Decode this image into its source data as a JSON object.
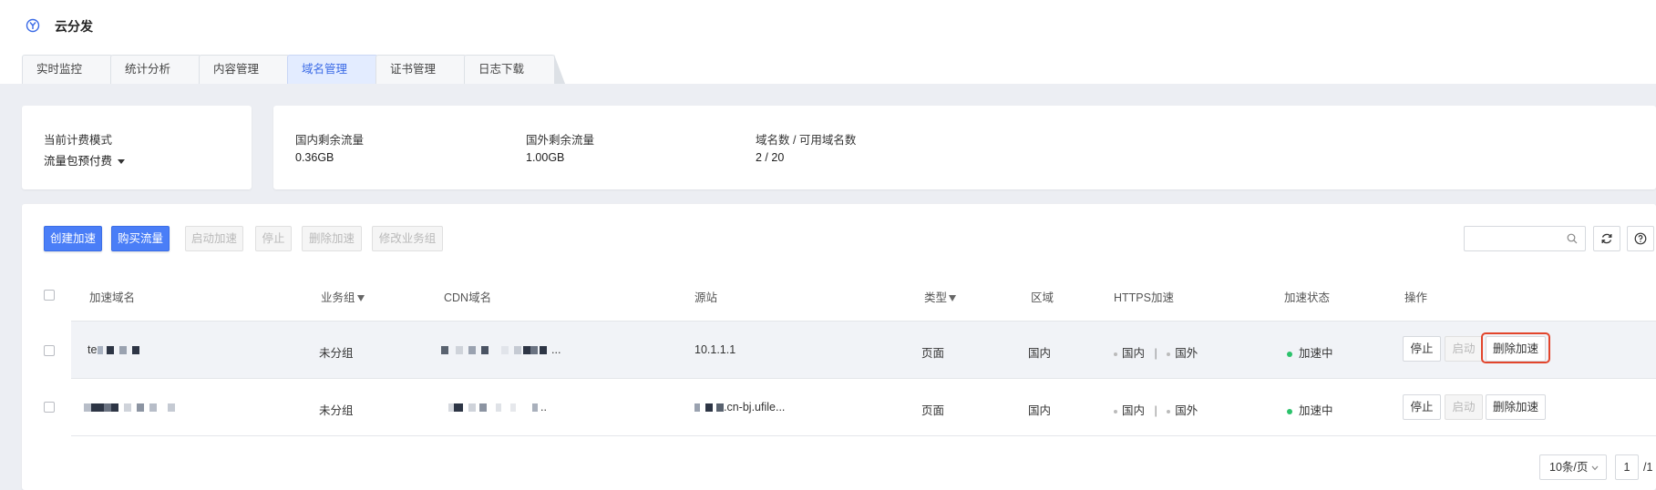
{
  "app": {
    "title": "云分发"
  },
  "tabs": [
    {
      "label": "实时监控"
    },
    {
      "label": "统计分析"
    },
    {
      "label": "内容管理"
    },
    {
      "label": "域名管理",
      "active": true
    },
    {
      "label": "证书管理"
    },
    {
      "label": "日志下载"
    }
  ],
  "billing": {
    "label": "当前计费模式",
    "value": "流量包预付费"
  },
  "stats": [
    {
      "label": "国内剩余流量",
      "value": "0.36GB"
    },
    {
      "label": "国外剩余流量",
      "value": "1.00GB"
    },
    {
      "label": "域名数 / 可用域名数",
      "value": "2 / 20"
    }
  ],
  "toolbar": {
    "create": "创建加速",
    "buy": "购买流量",
    "start": "启动加速",
    "stop": "停止",
    "delete": "删除加速",
    "modify_group": "修改业务组"
  },
  "search": {
    "placeholder": ""
  },
  "table": {
    "headers": [
      "加速域名",
      "业务组",
      "CDN域名",
      "源站",
      "类型",
      "区域",
      "HTTPS加速",
      "加速状态",
      "操作"
    ],
    "rows": [
      {
        "domain_prefix": "te",
        "group": "未分组",
        "cdn_suffix": "...",
        "origin": "10.1.1.1",
        "type": "页面",
        "region": "国内",
        "https_domestic": "国内",
        "https_sep": "|",
        "https_foreign": "国外",
        "status": "加速中",
        "actions": {
          "stop": "停止",
          "start": "启动",
          "delete": "删除加速"
        }
      },
      {
        "domain_prefix": "",
        "group": "未分组",
        "cdn_suffix": "..",
        "origin": ".cn-bj.ufile...",
        "type": "页面",
        "region": "国内",
        "https_domestic": "国内",
        "https_sep": "|",
        "https_foreign": "国外",
        "status": "加速中",
        "actions": {
          "stop": "停止",
          "start": "启动",
          "delete": "删除加速"
        }
      }
    ]
  },
  "pagination": {
    "page_size": "10条/页",
    "current": "1",
    "total": "/1"
  },
  "colors": {
    "accent": "#4a7ef7",
    "status_ok": "#2bc26b",
    "highlight": "#e2452c"
  }
}
